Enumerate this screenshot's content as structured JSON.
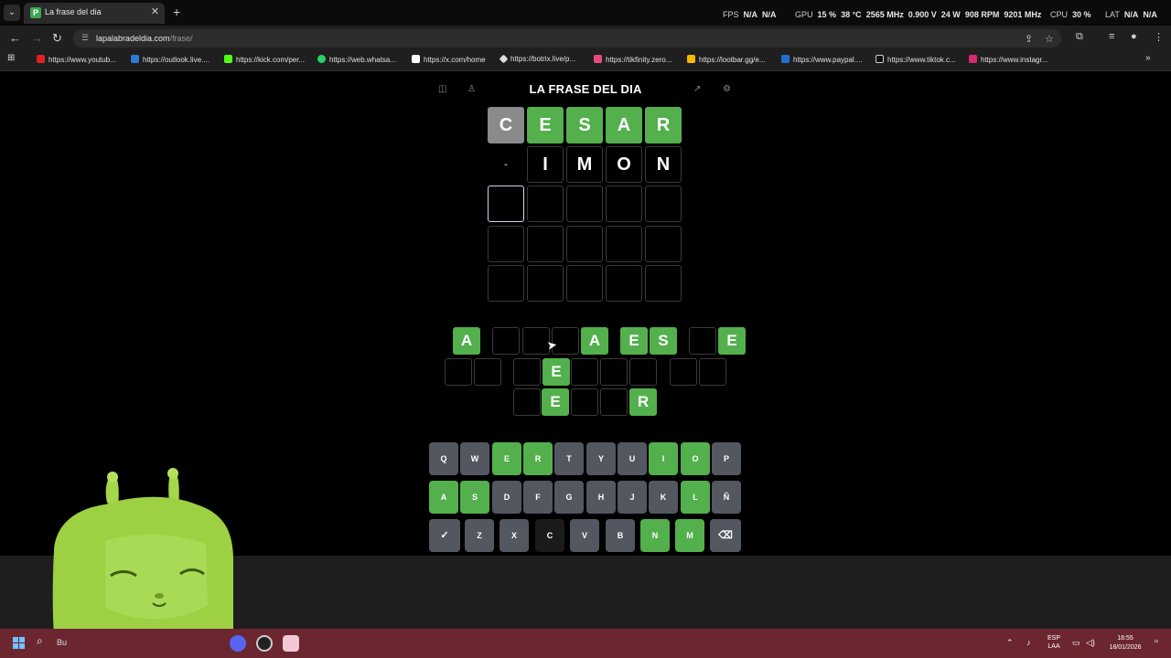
{
  "browser": {
    "tab_title": "La frase del dia",
    "tab_favicon_letter": "P",
    "url_host": "lapalabradeldia.com",
    "url_path": "/frase/",
    "bookmarks": [
      "https://www.youtub...",
      "https://outlook.live....",
      "https://kick.com/per...",
      "https://web.whatsa...",
      "https://x.com/home",
      "https://botrix.live/p...",
      "https://tikfinity.zero...",
      "https://lootbar.gg/e...",
      "https://www.paypal....",
      "https://www.tiktok.c...",
      "https://www.instagr..."
    ]
  },
  "overlay": {
    "fps_label": "FPS",
    "fps_value1": "N/A",
    "fps_value2": "N/A",
    "gpu_label": "GPU",
    "gpu_usage": "15 %",
    "gpu_temp": "38 °C",
    "gpu_clock": "2565 MHz",
    "gpu_voltage": "0.900 V",
    "gpu_power": "24 W",
    "gpu_fan": "908 RPM",
    "gpu_mem": "9201 MHz",
    "cpu_label": "CPU",
    "cpu_usage": "30 %",
    "lat_label": "LAT",
    "lat_value1": "N/A",
    "lat_value2": "N/A"
  },
  "game": {
    "title": "LA FRASE DEL DIA",
    "board": [
      [
        {
          "l": "C",
          "s": "gray"
        },
        {
          "l": "E",
          "s": "green"
        },
        {
          "l": "S",
          "s": "green"
        },
        {
          "l": "A",
          "s": "green"
        },
        {
          "l": "R",
          "s": "green"
        }
      ],
      [
        {
          "l": "-",
          "s": "blank"
        },
        {
          "l": "I",
          "s": "empty"
        },
        {
          "l": "M",
          "s": "empty"
        },
        {
          "l": "O",
          "s": "empty"
        },
        {
          "l": "N",
          "s": "empty"
        }
      ],
      [
        {
          "l": "",
          "s": "active"
        },
        {
          "l": "",
          "s": "empty"
        },
        {
          "l": "",
          "s": "empty"
        },
        {
          "l": "",
          "s": "empty"
        },
        {
          "l": "",
          "s": "empty"
        }
      ],
      [
        {
          "l": "",
          "s": "empty"
        },
        {
          "l": "",
          "s": "empty"
        },
        {
          "l": "",
          "s": "empty"
        },
        {
          "l": "",
          "s": "empty"
        },
        {
          "l": "",
          "s": "empty"
        }
      ],
      [
        {
          "l": "",
          "s": "empty"
        },
        {
          "l": "",
          "s": "empty"
        },
        {
          "l": "",
          "s": "empty"
        },
        {
          "l": "",
          "s": "empty"
        },
        {
          "l": "",
          "s": "empty"
        }
      ]
    ],
    "phrase_rows": [
      [
        "A",
        "",
        "",
        "",
        "A",
        "E",
        "S",
        "",
        "E"
      ],
      [
        "",
        "",
        "",
        "",
        "E",
        "",
        "",
        "",
        ""
      ],
      [
        "",
        "E",
        "",
        "",
        "R"
      ]
    ],
    "keyboard": [
      [
        {
          "k": "Q",
          "s": "gray"
        },
        {
          "k": "W",
          "s": "gray"
        },
        {
          "k": "E",
          "s": "green"
        },
        {
          "k": "R",
          "s": "green"
        },
        {
          "k": "T",
          "s": "gray"
        },
        {
          "k": "Y",
          "s": "gray"
        },
        {
          "k": "U",
          "s": "gray"
        },
        {
          "k": "I",
          "s": "green"
        },
        {
          "k": "O",
          "s": "green"
        },
        {
          "k": "P",
          "s": "gray"
        }
      ],
      [
        {
          "k": "A",
          "s": "green"
        },
        {
          "k": "S",
          "s": "green"
        },
        {
          "k": "D",
          "s": "gray"
        },
        {
          "k": "F",
          "s": "gray"
        },
        {
          "k": "G",
          "s": "gray"
        },
        {
          "k": "H",
          "s": "gray"
        },
        {
          "k": "J",
          "s": "gray"
        },
        {
          "k": "K",
          "s": "gray"
        },
        {
          "k": "L",
          "s": "green"
        },
        {
          "k": "Ñ",
          "s": "gray"
        }
      ],
      [
        {
          "k": "✓",
          "s": "action"
        },
        {
          "k": "Z",
          "s": "gray"
        },
        {
          "k": "X",
          "s": "gray"
        },
        {
          "k": "C",
          "s": "dark"
        },
        {
          "k": "V",
          "s": "gray"
        },
        {
          "k": "B",
          "s": "gray"
        },
        {
          "k": "N",
          "s": "green"
        },
        {
          "k": "M",
          "s": "green"
        },
        {
          "k": "⌫",
          "s": "action"
        }
      ]
    ]
  },
  "taskbar": {
    "search_text": "Bu",
    "lang_1": "ESP",
    "lang_2": "LAA",
    "time": "18:55",
    "date": "18/01/2026"
  },
  "colors": {
    "correct": "#53b04c",
    "absent": "#8a8a8a",
    "key": "#525760",
    "taskbar": "#6c2630"
  }
}
